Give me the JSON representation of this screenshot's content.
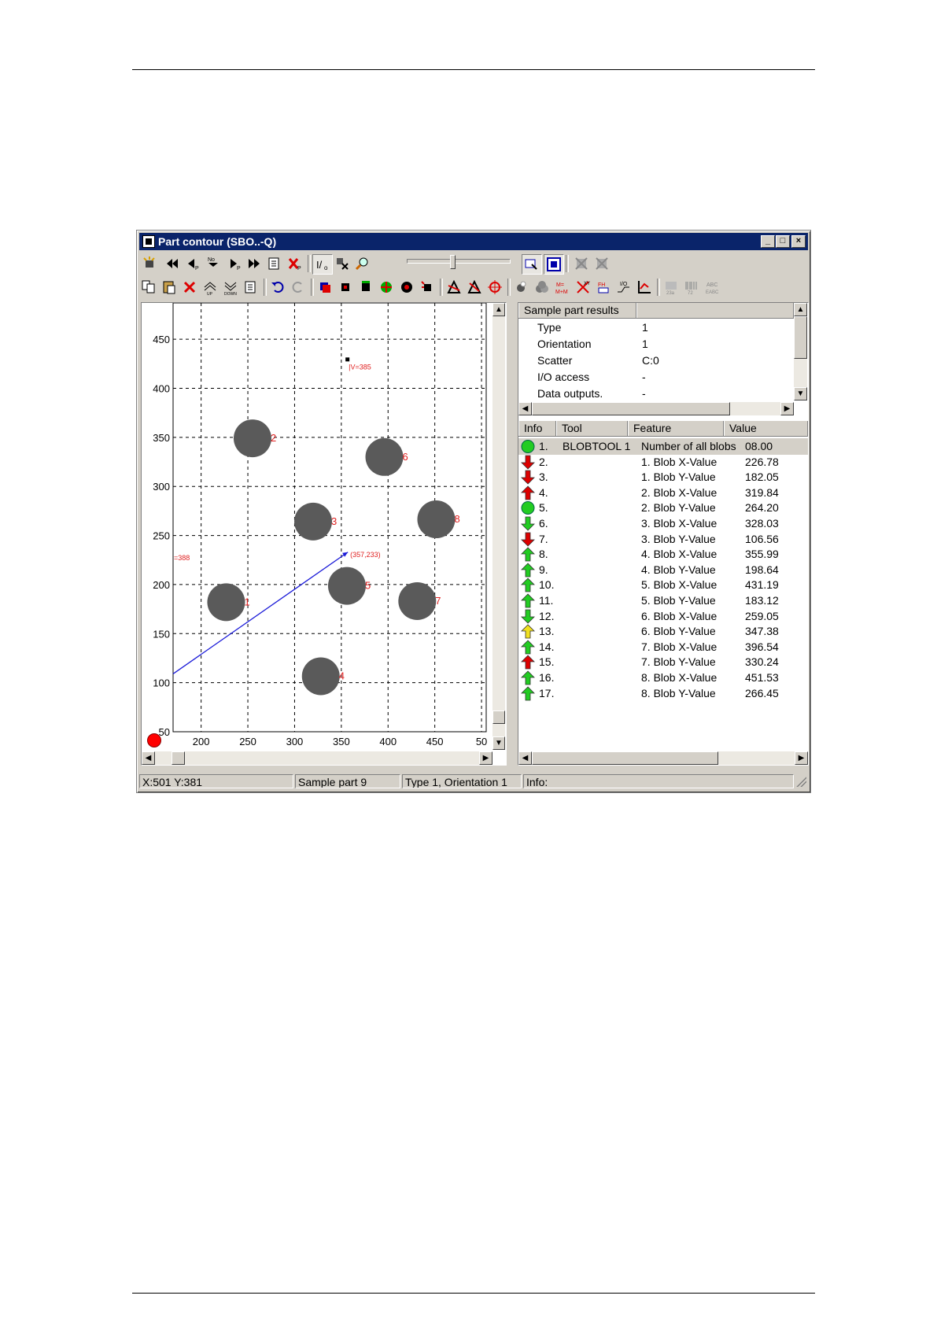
{
  "window": {
    "title": "Part contour (SBO..-Q)"
  },
  "titlebar_buttons": [
    "_",
    "□",
    "×"
  ],
  "plot": {
    "x_ticks": [
      "200",
      "250",
      "300",
      "350",
      "400",
      "450",
      "50"
    ],
    "y_ticks": [
      "450",
      "400",
      "350",
      "300",
      "250",
      "200",
      "150",
      "100",
      "50"
    ],
    "blob_labels": [
      "1",
      "2",
      "3",
      "4",
      "5",
      "6",
      "7",
      "8"
    ],
    "marker_top_label": "|V=385",
    "marker_left_label": "=388",
    "line_end_label": "(357,233)"
  },
  "chart_data": {
    "type": "scatter",
    "xlim": [
      170,
      505
    ],
    "ylim": [
      50,
      487
    ],
    "grid": true,
    "points": [
      {
        "label": "1",
        "x": 226.78,
        "y": 182.05
      },
      {
        "label": "2",
        "x": 255,
        "y": 349
      },
      {
        "label": "3",
        "x": 319.84,
        "y": 264.2
      },
      {
        "label": "4",
        "x": 328.03,
        "y": 106.56
      },
      {
        "label": "5",
        "x": 355.99,
        "y": 198.64
      },
      {
        "label": "6",
        "x": 396,
        "y": 330
      },
      {
        "label": "7",
        "x": 431.19,
        "y": 183.12
      },
      {
        "label": "8",
        "x": 451.53,
        "y": 266.45
      }
    ],
    "line": {
      "x": [
        170,
        357
      ],
      "y": [
        109,
        233
      ]
    },
    "markers": [
      {
        "x": 357,
        "y": 429
      },
      {
        "x": 170,
        "y": 228
      }
    ]
  },
  "status": {
    "coords": "X:501 Y:381",
    "sample": "Sample part 9",
    "type": "Type 1, Orientation 1",
    "info": "Info:"
  },
  "summary": {
    "header": "Sample part results",
    "rows": [
      {
        "key": "Type",
        "value": "1"
      },
      {
        "key": "Orientation",
        "value": "1"
      },
      {
        "key": "Scatter",
        "value": "C:0"
      },
      {
        "key": "I/O access",
        "value": "-"
      },
      {
        "key": "Data outputs.",
        "value": "-"
      }
    ]
  },
  "results": {
    "columns": [
      "Info",
      "Tool",
      "Feature",
      "Value"
    ],
    "rows": [
      {
        "icon": "green-circle",
        "n": "1.",
        "tool": "BLOBTOOL 1",
        "feature": "Number of all blobs",
        "value": "08.00"
      },
      {
        "icon": "red-down",
        "n": "2.",
        "tool": "",
        "feature": "1. Blob X-Value",
        "value": "226.78"
      },
      {
        "icon": "red-down",
        "n": "3.",
        "tool": "",
        "feature": "1. Blob Y-Value",
        "value": "182.05"
      },
      {
        "icon": "red-up",
        "n": "4.",
        "tool": "",
        "feature": "2. Blob X-Value",
        "value": "319.84"
      },
      {
        "icon": "green-circle",
        "n": "5.",
        "tool": "",
        "feature": "2. Blob Y-Value",
        "value": "264.20"
      },
      {
        "icon": "green-down",
        "n": "6.",
        "tool": "",
        "feature": "3. Blob X-Value",
        "value": "328.03"
      },
      {
        "icon": "red-down",
        "n": "7.",
        "tool": "",
        "feature": "3. Blob Y-Value",
        "value": "106.56"
      },
      {
        "icon": "green-up",
        "n": "8.",
        "tool": "",
        "feature": "4. Blob X-Value",
        "value": "355.99"
      },
      {
        "icon": "green-up",
        "n": "9.",
        "tool": "",
        "feature": "4. Blob Y-Value",
        "value": "198.64"
      },
      {
        "icon": "green-up",
        "n": "10.",
        "tool": "",
        "feature": "5. Blob X-Value",
        "value": "431.19"
      },
      {
        "icon": "green-up",
        "n": "11.",
        "tool": "",
        "feature": "5. Blob Y-Value",
        "value": "183.12"
      },
      {
        "icon": "green-down",
        "n": "12.",
        "tool": "",
        "feature": "6. Blob X-Value",
        "value": "259.05"
      },
      {
        "icon": "yellow-up",
        "n": "13.",
        "tool": "",
        "feature": "6. Blob Y-Value",
        "value": "347.38"
      },
      {
        "icon": "green-up",
        "n": "14.",
        "tool": "",
        "feature": "7. Blob X-Value",
        "value": "396.54"
      },
      {
        "icon": "red-up",
        "n": "15.",
        "tool": "",
        "feature": "7. Blob Y-Value",
        "value": "330.24"
      },
      {
        "icon": "green-up",
        "n": "16.",
        "tool": "",
        "feature": "8. Blob X-Value",
        "value": "451.53"
      },
      {
        "icon": "green-up",
        "n": "17.",
        "tool": "",
        "feature": "8. Blob Y-Value",
        "value": "266.45"
      }
    ]
  },
  "colors": {
    "titlebar": "#0a246a",
    "blob": "#5a5a5a",
    "blob_label": "#e02020",
    "line": "#1a1ad8",
    "grid": "#000000",
    "status_red": "#ff0000",
    "ok_green": "#22cc22",
    "bad_red": "#dd0000",
    "warn_yellow": "#f0e020"
  }
}
